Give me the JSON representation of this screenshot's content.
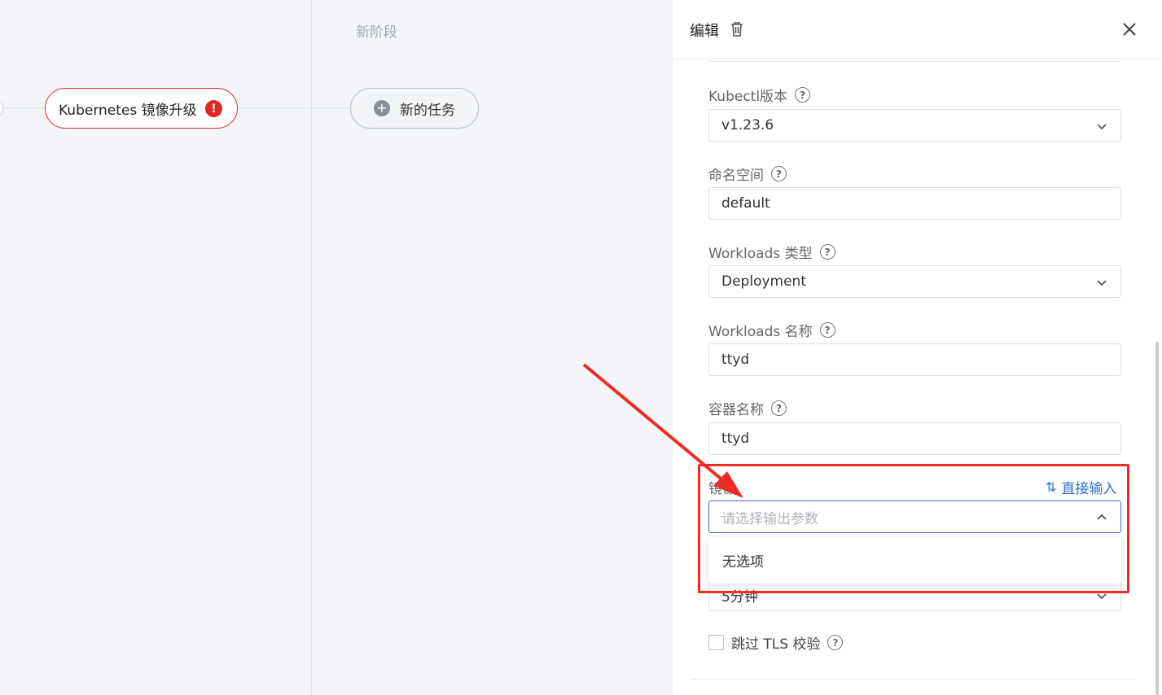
{
  "canvas": {
    "stage_title": "新阶段",
    "task_node_label": "Kubernetes 镜像升级",
    "task_error_glyph": "!",
    "new_task_label": "新的任务",
    "new_task_plus": "+"
  },
  "panel": {
    "title": "编辑",
    "fields": {
      "kubectl": {
        "label": "Kubectl版本",
        "value": "v1.23.6"
      },
      "namespace": {
        "label": "命名空间",
        "value": "default"
      },
      "workload_type": {
        "label": "Workloads 类型",
        "value": "Deployment"
      },
      "workload_name": {
        "label": "Workloads 名称",
        "value": "ttyd"
      },
      "container_name": {
        "label": "容器名称",
        "value": "ttyd"
      },
      "image": {
        "label": "镜像",
        "placeholder": "请选择输出参数",
        "direct_input": "直接输入",
        "swap_glyph": "⇅"
      },
      "timeout": {
        "value": "5分钟"
      }
    },
    "dropdown_empty": "无选项",
    "skip_tls_label": "跳过 TLS 校验",
    "help_glyph": "?"
  },
  "colors": {
    "accent": "#2f6fd1",
    "error": "#e0271f",
    "annotation": "#ee2b24"
  }
}
